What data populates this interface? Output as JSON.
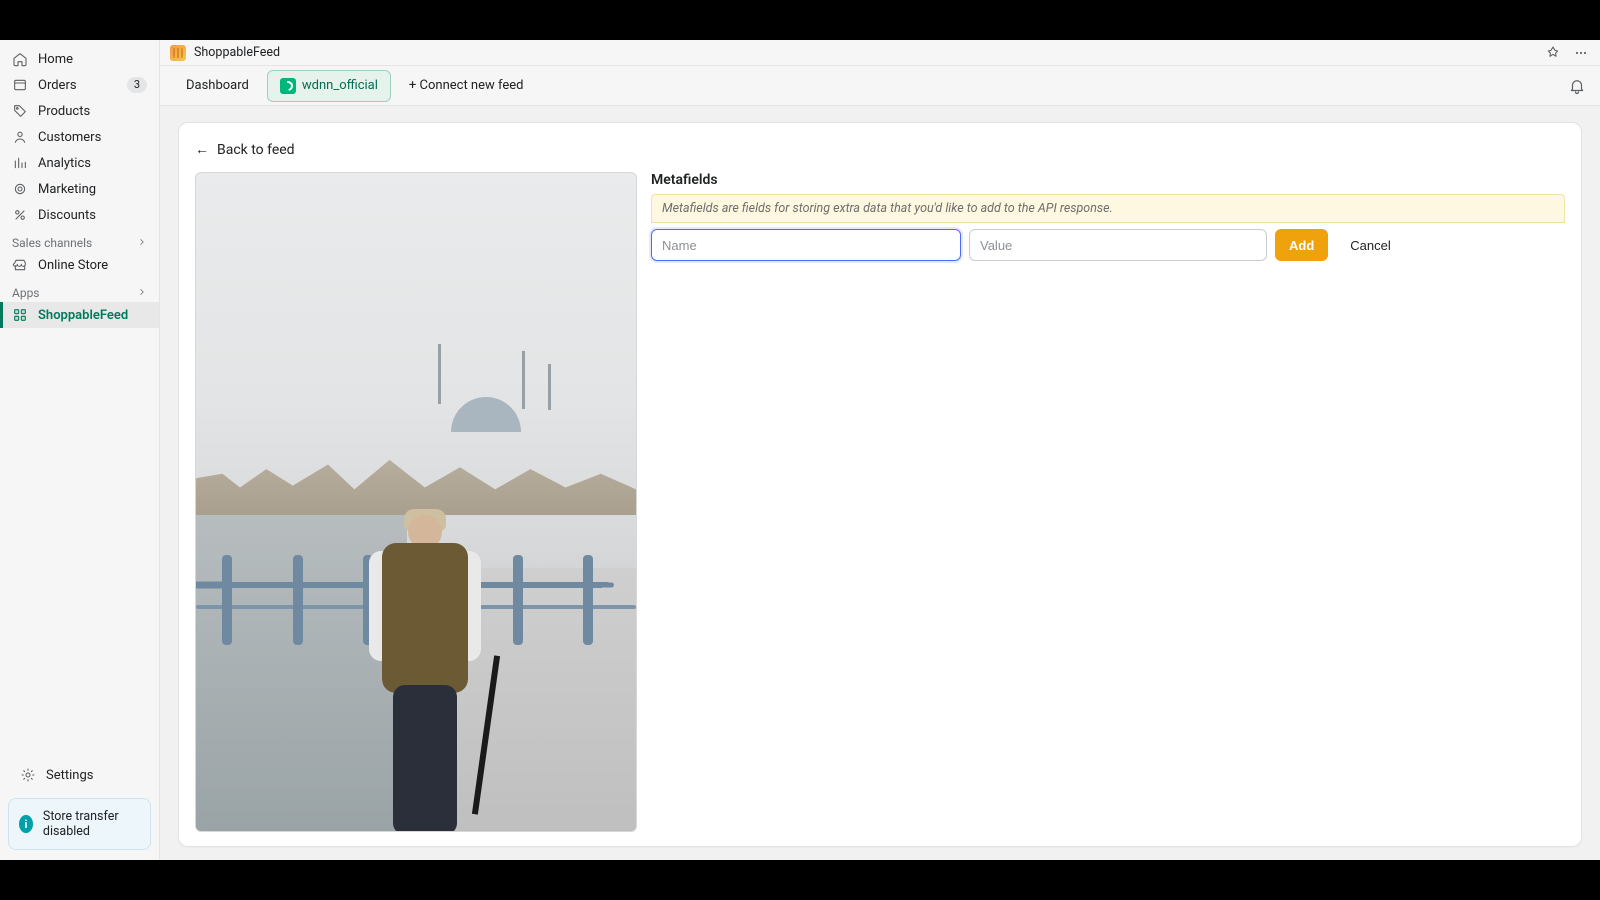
{
  "app": {
    "title": "ShoppableFeed"
  },
  "header_icons": {
    "pin": "pin",
    "more": "more"
  },
  "sidebar": {
    "items": [
      {
        "label": "Home"
      },
      {
        "label": "Orders",
        "badge": "3"
      },
      {
        "label": "Products"
      },
      {
        "label": "Customers"
      },
      {
        "label": "Analytics"
      },
      {
        "label": "Marketing"
      },
      {
        "label": "Discounts"
      }
    ],
    "sales_label": "Sales channels",
    "online_store": "Online Store",
    "apps_label": "Apps",
    "apps": [
      {
        "label": "ShoppableFeed",
        "active": true
      }
    ],
    "settings": "Settings",
    "status_card": "Store transfer disabled"
  },
  "tabs": {
    "dashboard": "Dashboard",
    "feed_name": "wdnn_official",
    "connect": "+ Connect new feed"
  },
  "page": {
    "back": "Back to feed",
    "meta_title": "Metafields",
    "meta_note": "Metafields are fields for storing extra data that you'd like to add to the API response.",
    "name_placeholder": "Name",
    "value_placeholder": "Value",
    "add": "Add",
    "cancel": "Cancel"
  }
}
